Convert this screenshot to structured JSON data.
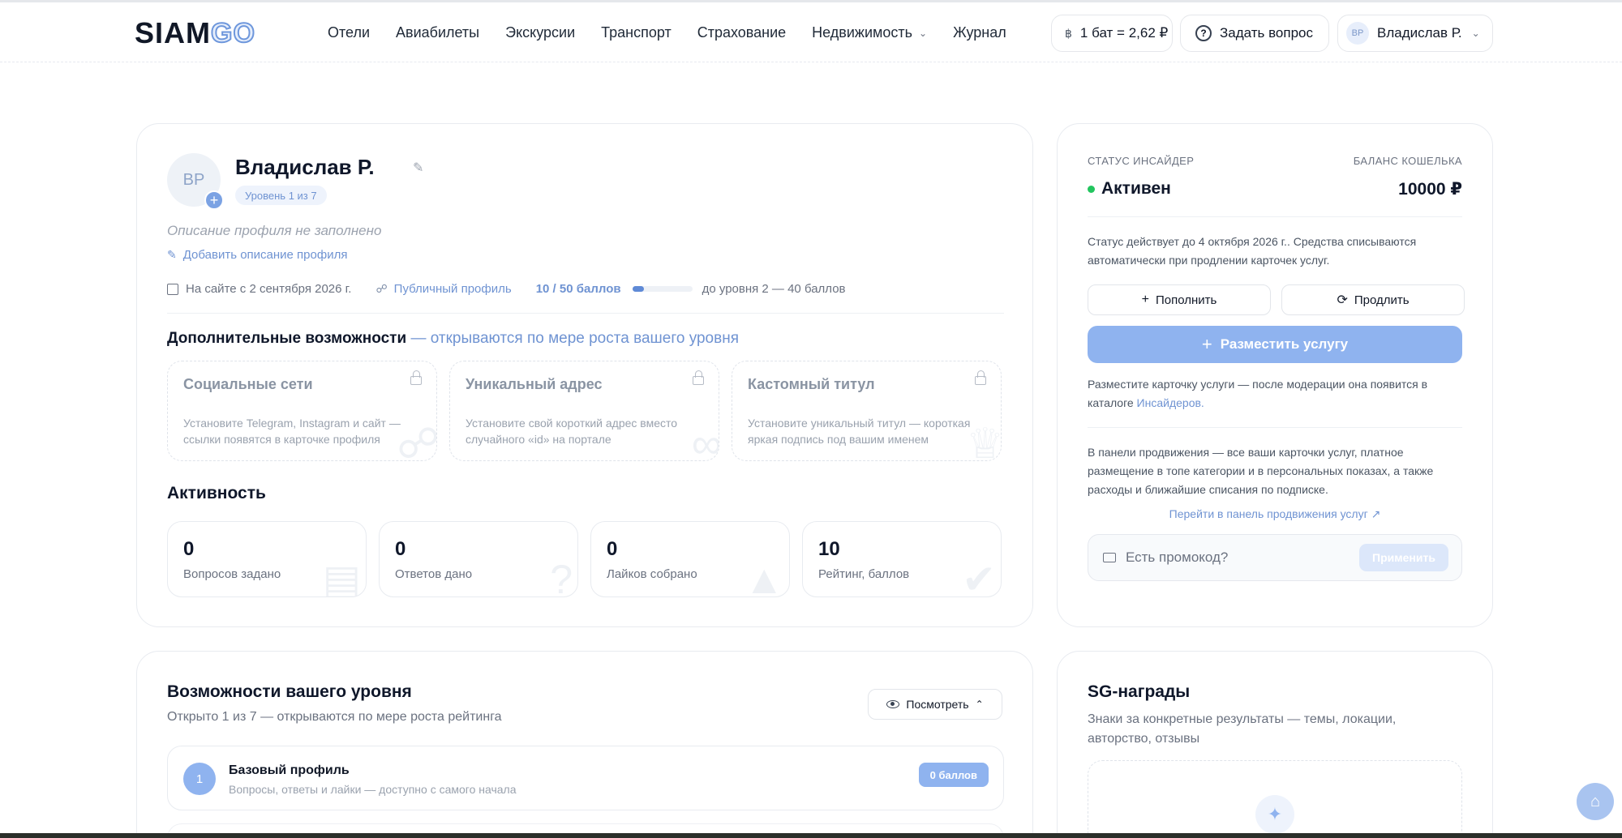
{
  "brand": {
    "part1": "SIAM",
    "part2": "GO"
  },
  "nav": [
    {
      "label": "Отели"
    },
    {
      "label": "Авиабилеты"
    },
    {
      "label": "Экскурсии"
    },
    {
      "label": "Транспорт"
    },
    {
      "label": "Страхование"
    },
    {
      "label": "Недвижимость",
      "dropdown": true
    },
    {
      "label": "Журнал"
    }
  ],
  "header": {
    "rate": "1 бат = 2,62 ₽",
    "ask": "Задать вопрос",
    "user_initials": "ВР",
    "user_name": "Владислав Р."
  },
  "profile": {
    "initials": "ВР",
    "name": "Владислав Р.",
    "level": "Уровень 1 из 7",
    "desc_empty": "Описание профиля не заполнено",
    "add_desc": "Добавить описание профиля",
    "since": "На сайте с 2 сентября 2026 г.",
    "public": "Публичный профиль",
    "points": "10 / 50 баллов",
    "progress_fraction": 0.2,
    "to_next": "до уровня 2 — 40 баллов"
  },
  "extra": {
    "title": "Дополнительные возможности",
    "subtitle": "— открываются по мере роста вашего уровня",
    "features": [
      {
        "title": "Социальные сети",
        "desc": "Установите Telegram, Instagram и сайт — ссылки появятся в карточке профиля",
        "icon": "share-icon"
      },
      {
        "title": "Уникальный адрес",
        "desc": "Установите свой короткий адрес вместо случайного «id» на портале",
        "icon": "link-icon"
      },
      {
        "title": "Кастомный титул",
        "desc": "Установите уникальный титул — короткая яркая подпись под вашим именем",
        "icon": "crown-icon"
      }
    ]
  },
  "activity": {
    "title": "Активность",
    "stats": [
      {
        "value": "0",
        "label": "Вопросов задано",
        "icon": "document-icon"
      },
      {
        "value": "0",
        "label": "Ответов дано",
        "icon": "question-icon"
      },
      {
        "value": "0",
        "label": "Лайков собрано",
        "icon": "thumb-icon"
      },
      {
        "value": "10",
        "label": "Рейтинг, баллов",
        "icon": "badge-check-icon"
      }
    ]
  },
  "wallet": {
    "status_label": "СТАТУС ИНСАЙДЕР",
    "balance_label": "БАЛАНС КОШЕЛЬКА",
    "status": "Активен",
    "balance": "10000 ₽",
    "valid_text": "Статус действует до 4 октября 2026 г.. Средства списываются автоматически при продлении карточек услуг.",
    "topup": "Пополнить",
    "renew": "Продлить",
    "place": "Разместить услугу",
    "place_text": "Разместите карточку услуги — после модерации она появится в каталоге",
    "place_link": "Инсайдеров.",
    "promo_text": "В панели продвижения — все ваши карточки услуг, платное размещение в топе категории и в персональных показах, а также расходы и ближайшие списания по подписке.",
    "promo_link": "Перейти в панель продвижения услуг ↗",
    "promo_placeholder": "Есть промокод?",
    "apply": "Применить"
  },
  "levels": {
    "title": "Возможности вашего уровня",
    "subtitle": "Открыто 1 из 7 — открываются по мере роста рейтинга",
    "view": "Посмотреть",
    "rows": [
      {
        "num": "1",
        "title": "Базовый профиль",
        "desc": "Вопросы, ответы и лайки — доступно с самого начала",
        "badge": "0 баллов"
      }
    ]
  },
  "awards": {
    "title": "SG-награды",
    "subtitle": "Знаки за конкретные результаты — темы, локации, авторство, отзывы"
  },
  "colors": {
    "accent": "#6f93d2",
    "primary_button": "#8fb3ef",
    "active": "#22c55e"
  }
}
